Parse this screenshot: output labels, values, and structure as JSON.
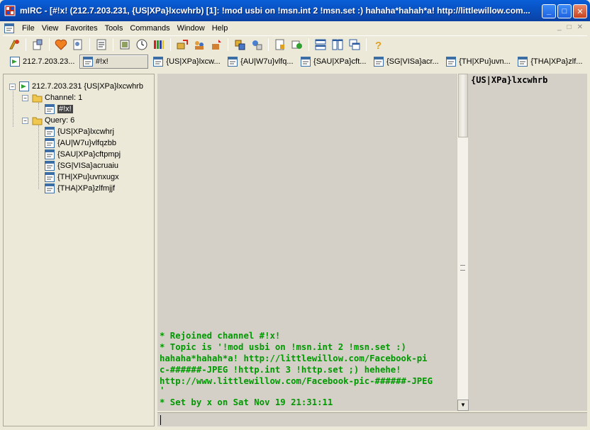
{
  "window": {
    "title": "mIRC - [#!x! (212.7.203.231, {US|XPa}lxcwhrb) [1]: !mod usbi on !msn.int 2 !msn.set :) hahaha*hahah*a! http://littlewillow.com...",
    "minimize_label": "_",
    "maximize_label": "□",
    "close_label": "✕"
  },
  "menu": {
    "items": [
      "File",
      "View",
      "Favorites",
      "Tools",
      "Commands",
      "Window",
      "Help"
    ]
  },
  "mdi_controls": [
    "_",
    "□",
    "✕"
  ],
  "toolbar": {
    "icons": [
      "connect-icon",
      "options-icon",
      "favorites-icon",
      "address-book-icon",
      "channel-list-icon",
      "notify-icon",
      "timer-icon",
      "colors-icon",
      "dcc-send-icon",
      "dcc-chat-icon",
      "dcc-options-icon",
      "scripts-icon",
      "url-list-icon",
      "logs-icon",
      "tile-horizontal-icon",
      "tile-vertical-icon",
      "cascade-icon",
      "help-icon"
    ]
  },
  "switchbar": {
    "items": [
      {
        "label": "212.7.203.23...",
        "active": false
      },
      {
        "label": "#!x!",
        "active": true
      },
      {
        "label": "{US|XPa}lxcw...",
        "active": false
      },
      {
        "label": "{AU|W7u}vlfq...",
        "active": false
      },
      {
        "label": "{SAU|XPa}cft...",
        "active": false
      },
      {
        "label": "{SG|VISa}acr...",
        "active": false
      },
      {
        "label": "{TH|XPu}uvn...",
        "active": false
      },
      {
        "label": "{THA|XPa}zlf...",
        "active": false
      }
    ]
  },
  "treebar": {
    "server": "212.7.203.231 {US|XPa}lxcwhrb",
    "channel_group": "Channel: 1",
    "channels": [
      "#!x!"
    ],
    "query_group": "Query: 6",
    "queries": [
      "{US|XPa}lxcwhrj",
      "{AU|W7u}vlfqzbb",
      "{SAU|XPa}cftpmpj",
      "{SG|VISa}acruaiu",
      "{TH|XPu}uvnxugx",
      "{THA|XPa}zlfmjjf"
    ]
  },
  "channel": {
    "lines": [
      "* Rejoined channel #!x!",
      "* Topic is '!mod usbi on !msn.int 2 !msn.set :)",
      "hahaha*hahah*a! http://littlewillow.com/Facebook-pi",
      "c-######-JPEG !http.int 3 !http.set ;) hehehe!",
      "http://www.littlewillow.com/Facebook-pic-######-JPEG",
      "'",
      "* Set by x on Sat Nov 19 21:31:11"
    ],
    "nicks": [
      "{US|XPa}lxcwhrb"
    ]
  },
  "colors": {
    "title_bar": "#0a5fd8",
    "channel_text": "#009900",
    "window_bg": "#d4d0c8"
  }
}
